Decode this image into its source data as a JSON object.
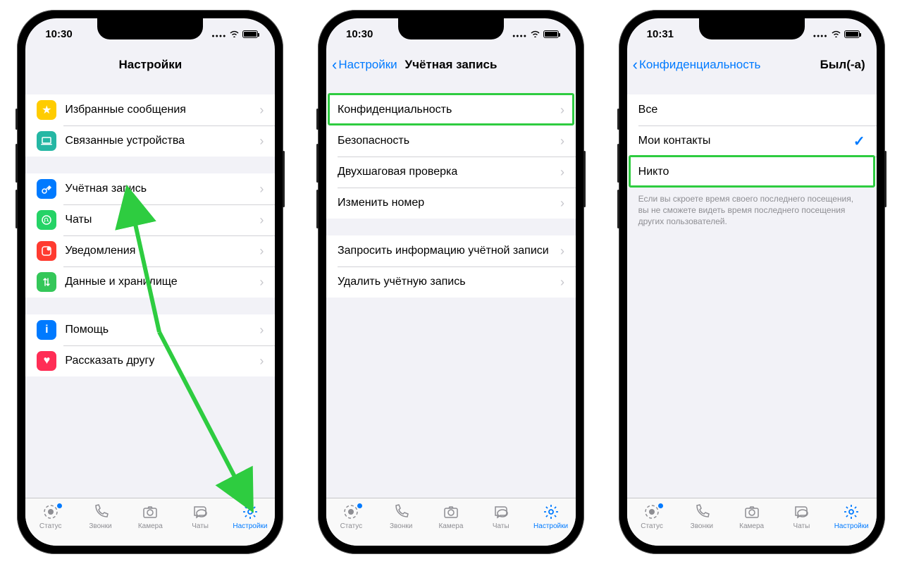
{
  "screens": [
    {
      "time": "10:30",
      "title": "Настройки",
      "back": null,
      "groups": [
        [
          {
            "icon_bg": "#ffcc00",
            "icon": "★",
            "label": "Избранные сообщения"
          },
          {
            "icon_bg": "#34c7a0",
            "icon": "⌂",
            "label": "Связанные устройства"
          }
        ],
        [
          {
            "icon_bg": "#007aff",
            "icon": "🔑",
            "label": "Учётная запись"
          },
          {
            "icon_bg": "#25d366",
            "icon": "✆",
            "label": "Чаты"
          },
          {
            "icon_bg": "#ff3b30",
            "icon": "◉",
            "label": "Уведомления"
          },
          {
            "icon_bg": "#34c759",
            "icon": "⇅",
            "label": "Данные и хранилище"
          }
        ],
        [
          {
            "icon_bg": "#007aff",
            "icon": "i",
            "label": "Помощь"
          },
          {
            "icon_bg": "#ff2d55",
            "icon": "♡",
            "label": "Рассказать другу"
          }
        ]
      ]
    },
    {
      "time": "10:30",
      "title": "Учётная запись",
      "back": "Настройки",
      "groups": [
        [
          {
            "label": "Конфиденциальность",
            "highlight": true
          },
          {
            "label": "Безопасность"
          },
          {
            "label": "Двухшаговая проверка"
          },
          {
            "label": "Изменить номер"
          }
        ],
        [
          {
            "label": "Запросить информацию учётной записи"
          },
          {
            "label": "Удалить учётную запись"
          }
        ]
      ]
    },
    {
      "time": "10:31",
      "title": "Был(-а)",
      "back": "Конфиденциальность",
      "options": [
        {
          "label": "Все",
          "checked": false
        },
        {
          "label": "Мои контакты",
          "checked": true
        },
        {
          "label": "Никто",
          "checked": false,
          "highlight": true
        }
      ],
      "footer": "Если вы скроете время своего последнего посещения, вы не сможете видеть время последнего посещения других пользователей."
    }
  ],
  "tabs": [
    {
      "label": "Статус",
      "icon": "status"
    },
    {
      "label": "Звонки",
      "icon": "phone"
    },
    {
      "label": "Камера",
      "icon": "camera"
    },
    {
      "label": "Чаты",
      "icon": "chat"
    },
    {
      "label": "Настройки",
      "icon": "gear",
      "active": true
    }
  ]
}
